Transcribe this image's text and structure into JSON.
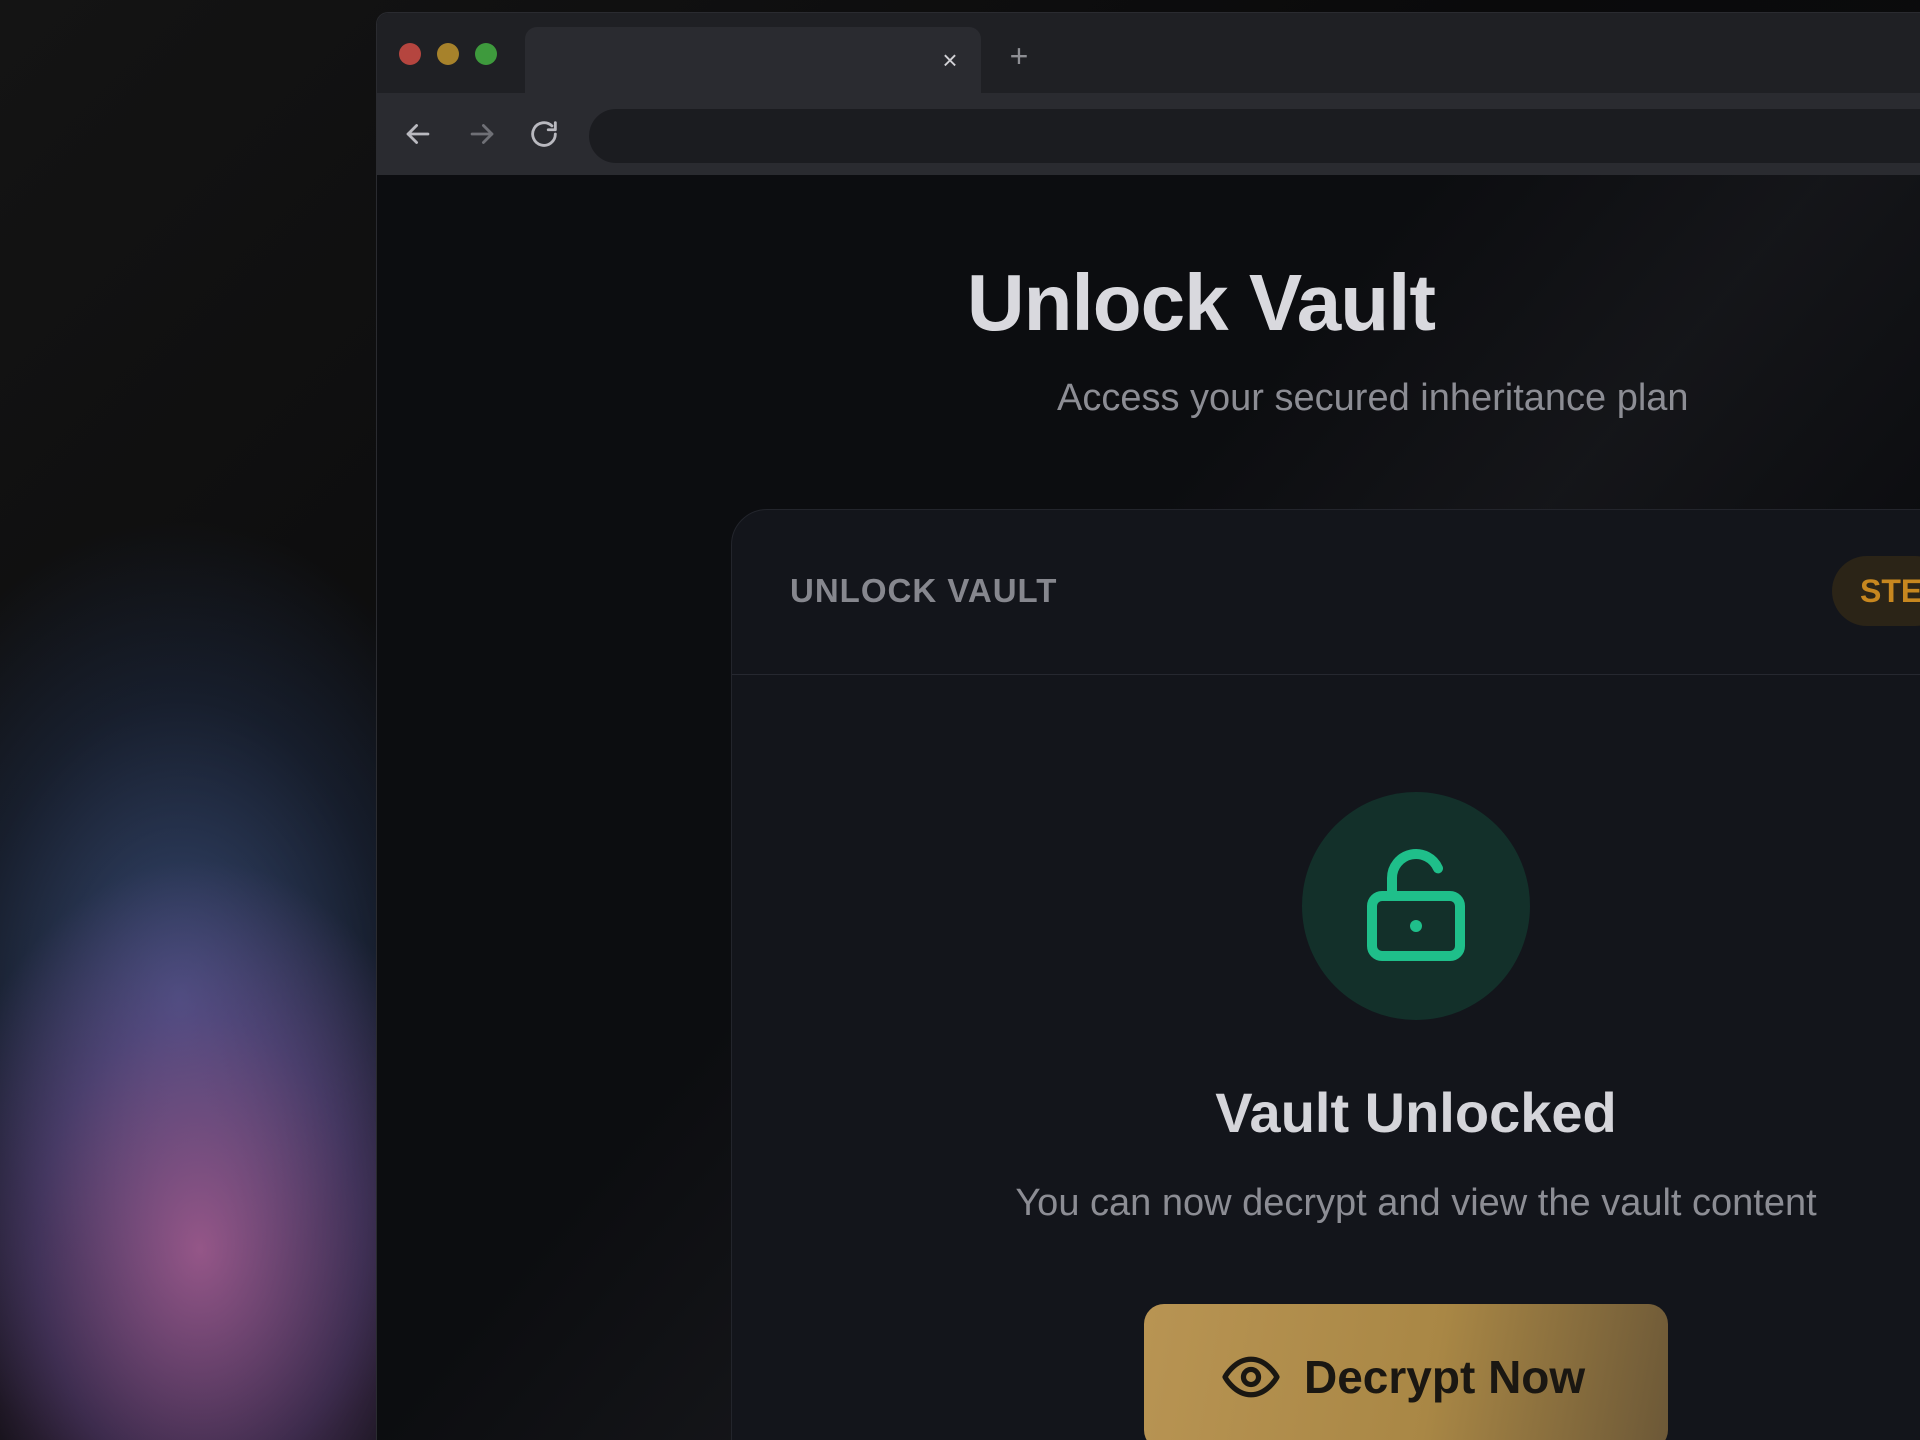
{
  "browser": {
    "tab_title": "",
    "tab_close_glyph": "×",
    "new_tab_glyph": "+",
    "address": ""
  },
  "page": {
    "title": "Unlock Vault",
    "subtitle": "Access your secured inheritance plan"
  },
  "card": {
    "header_title": "UNLOCK VAULT",
    "step_badge": "STE",
    "status_title": "Vault Unlocked",
    "status_description": "You can now decrypt and view the vault content",
    "decrypt_button_label": "Decrypt Now"
  },
  "colors": {
    "accent_gold": "#b89453",
    "success_green": "#1fbf8a",
    "step_badge_text": "#c7871f"
  },
  "icons": {
    "nav_back": "arrow-left-icon",
    "nav_forward": "arrow-right-icon",
    "reload": "reload-icon",
    "lock": "unlocked-padlock-icon",
    "decrypt": "eye-icon"
  }
}
